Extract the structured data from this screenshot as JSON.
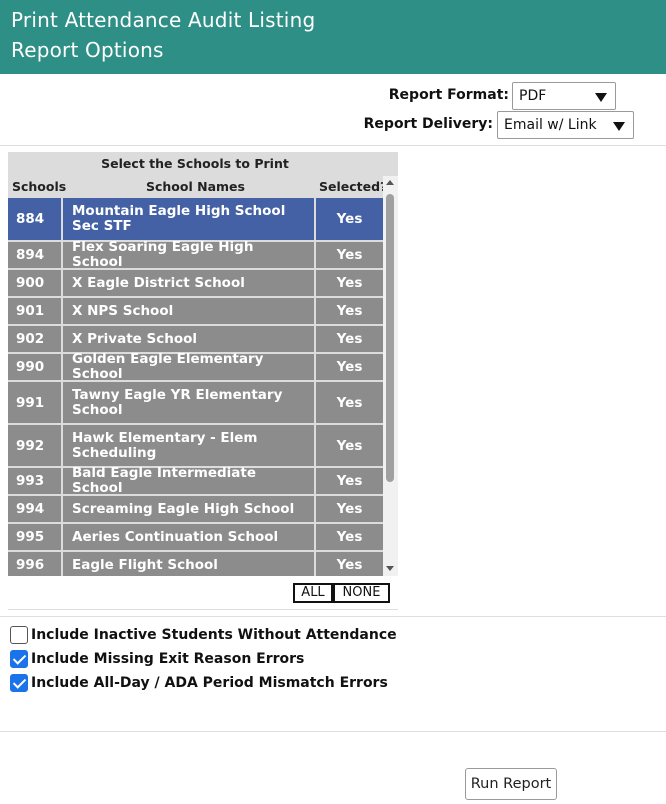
{
  "header": {
    "title_line1": "Print Attendance Audit Listing",
    "title_line2": "Report Options",
    "bg_color": "#2e8f86"
  },
  "options": {
    "report_format_label": "Report Format:",
    "report_format_value": "PDF",
    "report_delivery_label": "Report Delivery:",
    "report_delivery_value": "Email w/ Link"
  },
  "schools_grid": {
    "title": "Select the Schools to Print",
    "columns": [
      "Schools",
      "School Names",
      "Selected?"
    ],
    "rows": [
      {
        "code": "884",
        "name": "Mountain Eagle High School Sec STF",
        "selected": "Yes",
        "highlighted": true
      },
      {
        "code": "894",
        "name": "Flex Soaring Eagle High School",
        "selected": "Yes"
      },
      {
        "code": "900",
        "name": "X Eagle District School",
        "selected": "Yes"
      },
      {
        "code": "901",
        "name": "X NPS School",
        "selected": "Yes"
      },
      {
        "code": "902",
        "name": "X Private School",
        "selected": "Yes"
      },
      {
        "code": "990",
        "name": "Golden Eagle Elementary School",
        "selected": "Yes"
      },
      {
        "code": "991",
        "name": "Tawny Eagle YR Elementary School",
        "selected": "Yes"
      },
      {
        "code": "992",
        "name": "Hawk Elementary - Elem Scheduling",
        "selected": "Yes"
      },
      {
        "code": "993",
        "name": "Bald Eagle Intermediate School",
        "selected": "Yes"
      },
      {
        "code": "994",
        "name": "Screaming Eagle High School",
        "selected": "Yes"
      },
      {
        "code": "995",
        "name": "Aeries Continuation School",
        "selected": "Yes"
      },
      {
        "code": "996",
        "name": "Eagle Flight School",
        "selected": "Yes"
      }
    ],
    "highlight_color": "#4361a4",
    "row_color": "#8c8c8c",
    "all_label": "ALL",
    "none_label": "NONE"
  },
  "checkboxes": [
    {
      "label": "Include Inactive Students Without Attendance",
      "checked": false
    },
    {
      "label": "Include Missing Exit Reason Errors",
      "checked": true
    },
    {
      "label": "Include All-Day / ADA Period Mismatch Errors",
      "checked": true
    }
  ],
  "run_button_label": "Run Report"
}
